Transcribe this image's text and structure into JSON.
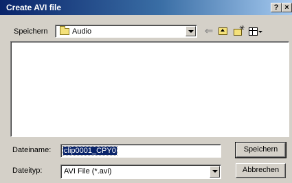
{
  "window": {
    "title": "Create AVI file",
    "help_label": "?",
    "close_label": "×"
  },
  "lookin": {
    "label": "Speichern",
    "value": "Audio"
  },
  "toolbar": {
    "back_icon": "back-arrow-icon",
    "up_icon": "up-folder-icon",
    "new_folder_icon": "new-folder-icon",
    "view_icon": "view-menu-icon"
  },
  "filename": {
    "label": "Dateiname:",
    "value": "clip0001_CPY0"
  },
  "filetype": {
    "label": "Dateityp:",
    "value": "AVI File (*.avi)"
  },
  "buttons": {
    "save_label": "Speichern",
    "cancel_label": "Abbrechen"
  }
}
